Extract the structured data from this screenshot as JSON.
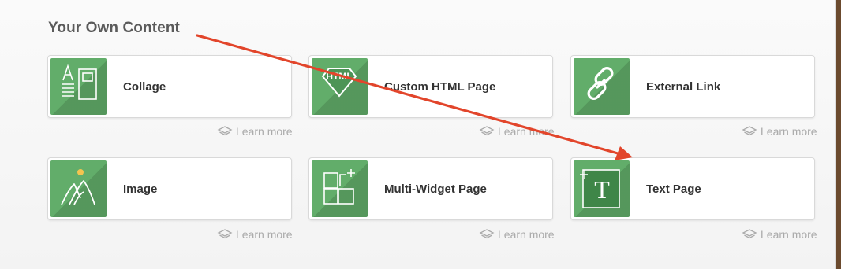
{
  "section": {
    "title": "Your Own Content"
  },
  "cards": [
    {
      "label": "Collage",
      "icon": "collage-icon",
      "learn_more": "Learn more"
    },
    {
      "label": "Custom HTML Page",
      "icon": "html-badge-icon",
      "icon_text": "HTML",
      "learn_more": "Learn more"
    },
    {
      "label": "External Link",
      "icon": "link-icon",
      "learn_more": "Learn more"
    },
    {
      "label": "Image",
      "icon": "image-icon",
      "learn_more": "Learn more"
    },
    {
      "label": "Multi-Widget Page",
      "icon": "multi-widget-icon",
      "learn_more": "Learn more"
    },
    {
      "label": "Text Page",
      "icon": "text-page-icon",
      "icon_text": "T",
      "learn_more": "Learn more"
    }
  ],
  "colors": {
    "tile_green": "#62ad6a",
    "arrow_red": "#e2452b",
    "learn_more_gray": "#aaaaaa"
  },
  "annotation": {
    "type": "arrow",
    "from": "section-title",
    "to": "text-page-card"
  }
}
